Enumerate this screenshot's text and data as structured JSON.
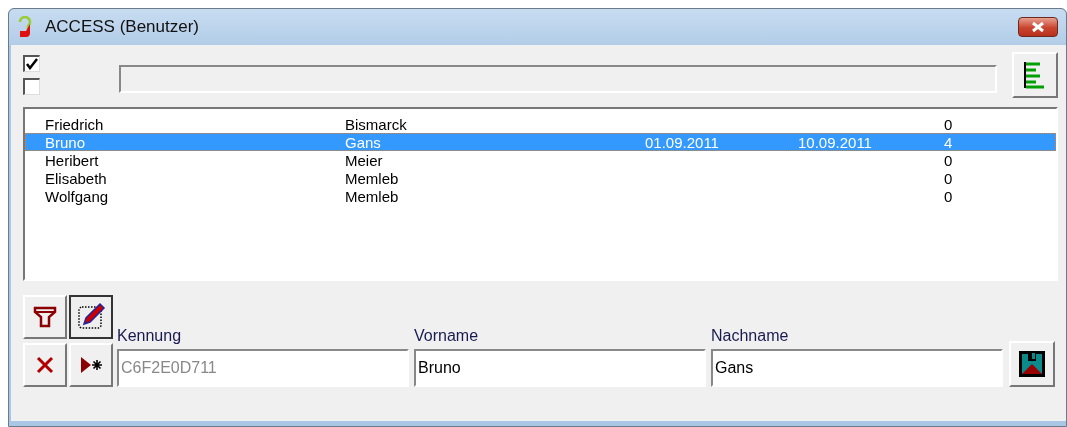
{
  "window": {
    "title": "ACCESS (Benutzer)"
  },
  "progress_bar": {
    "level": 0
  },
  "checkboxes": [
    {
      "checked": true
    },
    {
      "checked": false
    }
  ],
  "list": {
    "rows": [
      {
        "cells": [
          "Friedrich",
          "Bismarck",
          "",
          "",
          "0"
        ],
        "selected": false
      },
      {
        "cells": [
          "Bruno",
          "Gans",
          "01.09.2011",
          "10.09.2011",
          "4"
        ],
        "selected": true
      },
      {
        "cells": [
          "Heribert",
          "Meier",
          "",
          "",
          "0"
        ],
        "selected": false
      },
      {
        "cells": [
          "Elisabeth",
          "Memleb",
          "",
          "",
          "0"
        ],
        "selected": false
      },
      {
        "cells": [
          "Wolfgang",
          "Memleb",
          "",
          "",
          "0"
        ],
        "selected": false
      }
    ]
  },
  "form": {
    "fields": [
      {
        "label": "Kennung",
        "value": "C6F2E0D711",
        "disabled": true
      },
      {
        "label": "Vorname",
        "value": "Bruno",
        "disabled": false
      },
      {
        "label": "Nachname",
        "value": "Gans",
        "disabled": false
      }
    ]
  }
}
